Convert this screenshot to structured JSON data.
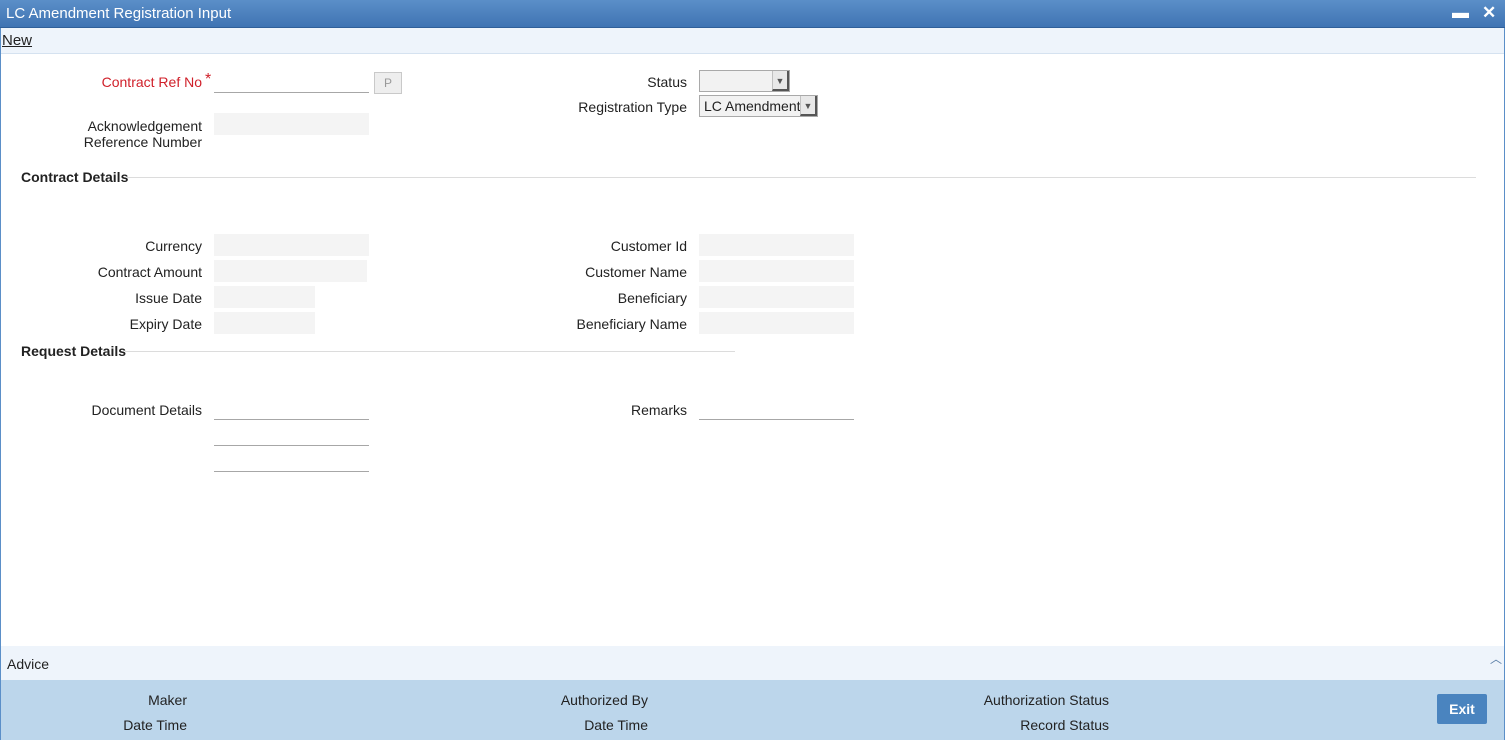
{
  "window": {
    "title": "LC Amendment Registration Input",
    "minimize": "▬",
    "close": "✕"
  },
  "menu": {
    "new": "New"
  },
  "header": {
    "contract_ref_label": "Contract Ref No",
    "required_mark": "*",
    "p_button": "P",
    "ack_ref_label": "Acknowledgement Reference Number",
    "status_label": "Status",
    "status_value": "",
    "registration_type_label": "Registration Type",
    "registration_type_value": "LC Amendment"
  },
  "contract_details": {
    "title": "Contract Details",
    "currency_label": "Currency",
    "contract_amount_label": "Contract Amount",
    "issue_date_label": "Issue Date",
    "expiry_date_label": "Expiry Date",
    "customer_id_label": "Customer Id",
    "customer_name_label": "Customer Name",
    "beneficiary_label": "Beneficiary",
    "beneficiary_name_label": "Beneficiary Name"
  },
  "request_details": {
    "title": "Request Details",
    "document_details_label": "Document Details",
    "remarks_label": "Remarks"
  },
  "advice": {
    "label": "Advice",
    "collapse_icon": "︿"
  },
  "footer": {
    "maker": "Maker",
    "date_time_1": "Date Time",
    "authorized_by": "Authorized By",
    "date_time_2": "Date Time",
    "authorization_status": "Authorization Status",
    "record_status": "Record Status",
    "exit": "Exit"
  }
}
